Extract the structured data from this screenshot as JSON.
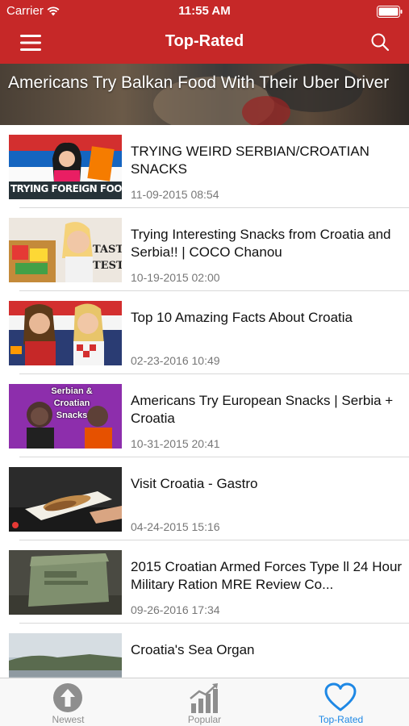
{
  "status_bar": {
    "carrier": "Carrier",
    "time": "11:55 AM"
  },
  "nav": {
    "title": "Top-Rated"
  },
  "featured": {
    "title": "Americans Try Balkan Food With Their Uber Driver"
  },
  "videos": [
    {
      "title": "TRYING WEIRD SERBIAN/CROATIAN SNACKS",
      "date": "11-09-2015 08:54",
      "thumb_caption": "TRYING FOREIGN FOOD"
    },
    {
      "title": "Trying Interesting Snacks from Croatia and Serbia!! | COCO Chanou",
      "date": "10-19-2015 02:00",
      "thumb_caption": "TASTE TEST!"
    },
    {
      "title": "Top 10 Amazing Facts About Croatia",
      "date": "02-23-2016 10:49"
    },
    {
      "title": "Americans Try European Snacks | Serbia + Croatia",
      "date": "10-31-2015 20:41",
      "thumb_caption": "Serbian & Croatian Snacks"
    },
    {
      "title": "Visit Croatia - Gastro",
      "date": "04-24-2015 15:16"
    },
    {
      "title": "2015 Croatian Armed Forces Type ll 24 Hour Military Ration MRE Review Co...",
      "date": "09-26-2016 17:34"
    },
    {
      "title": "Croatia's Sea Organ",
      "date": ""
    }
  ],
  "tabs": [
    {
      "label": "Newest",
      "icon": "arrow-up-circle-icon"
    },
    {
      "label": "Popular",
      "icon": "bar-chart-icon"
    },
    {
      "label": "Top-Rated",
      "icon": "heart-icon"
    }
  ],
  "colors": {
    "nav_bg": "#c62828",
    "accent": "#1e88e5",
    "tab_inactive": "#8e8e8e"
  }
}
